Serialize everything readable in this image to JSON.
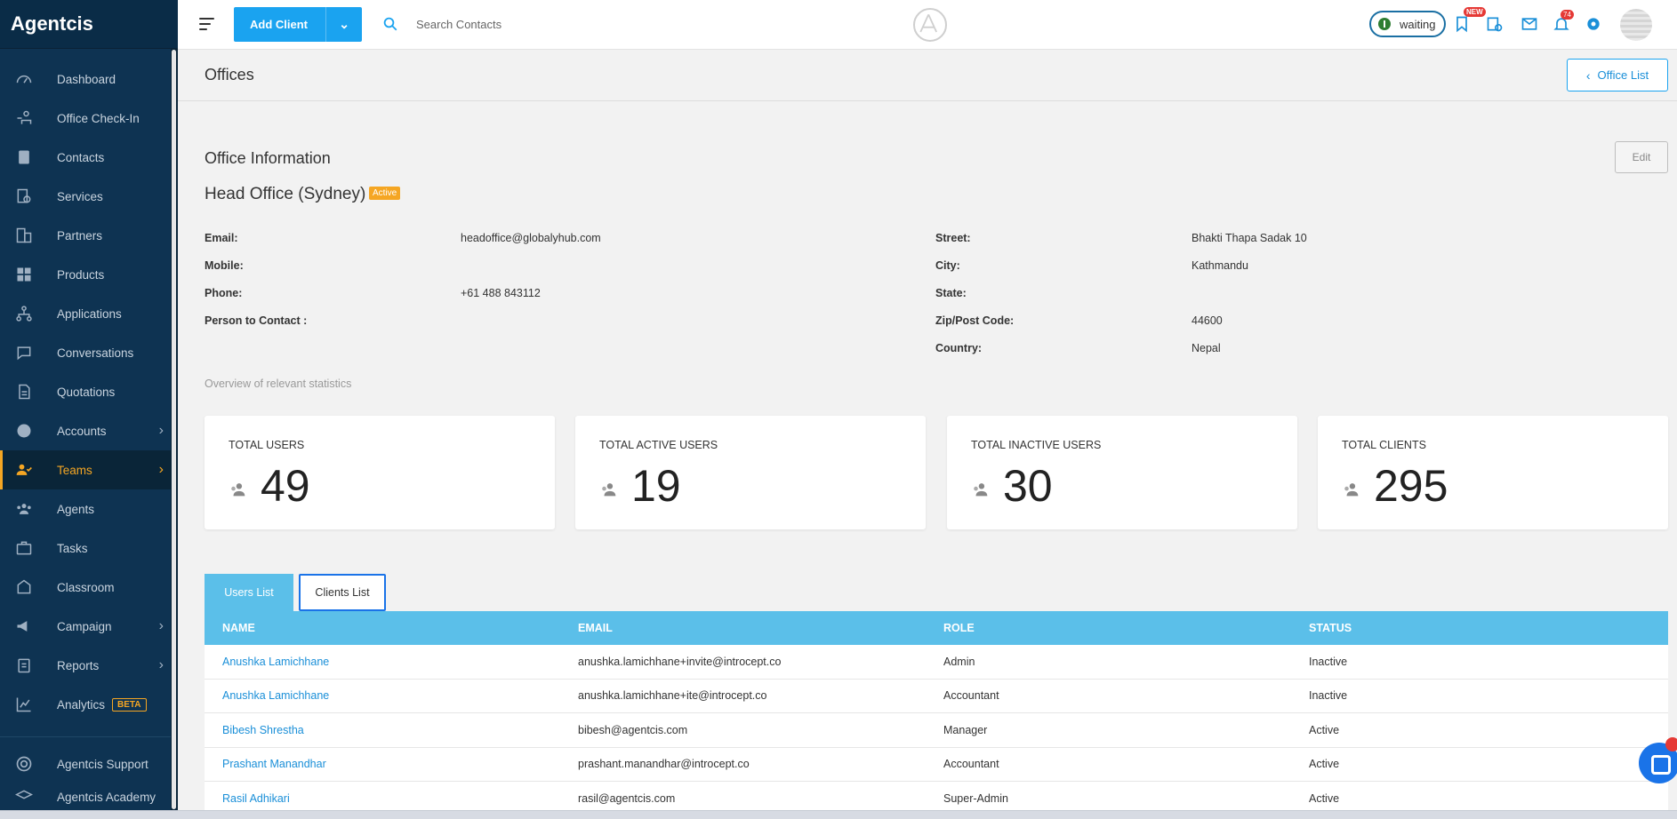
{
  "app": {
    "brand": "Agentcis"
  },
  "sidebar": {
    "items": [
      {
        "label": "Dashboard",
        "icon": "dashboard-icon"
      },
      {
        "label": "Office Check-In",
        "icon": "office-checkin-icon"
      },
      {
        "label": "Contacts",
        "icon": "contacts-icon"
      },
      {
        "label": "Services",
        "icon": "services-icon"
      },
      {
        "label": "Partners",
        "icon": "partners-icon"
      },
      {
        "label": "Products",
        "icon": "products-icon"
      },
      {
        "label": "Applications",
        "icon": "applications-icon"
      },
      {
        "label": "Conversations",
        "icon": "conversations-icon"
      },
      {
        "label": "Quotations",
        "icon": "quotations-icon"
      },
      {
        "label": "Accounts",
        "icon": "accounts-icon",
        "expandable": true
      },
      {
        "label": "Teams",
        "icon": "teams-icon",
        "expandable": true,
        "active": true
      },
      {
        "label": "Agents",
        "icon": "agents-icon"
      },
      {
        "label": "Tasks",
        "icon": "tasks-icon"
      },
      {
        "label": "Classroom",
        "icon": "classroom-icon"
      },
      {
        "label": "Campaign",
        "icon": "campaign-icon",
        "expandable": true
      },
      {
        "label": "Reports",
        "icon": "reports-icon",
        "expandable": true
      },
      {
        "label": "Analytics",
        "icon": "analytics-icon",
        "badge": "BETA"
      }
    ],
    "footer_items": [
      {
        "label": "Agentcis Support",
        "icon": "support-icon"
      },
      {
        "label": "Agentcis Academy",
        "icon": "academy-icon"
      }
    ]
  },
  "topbar": {
    "add_client_label": "Add Client",
    "search_placeholder": "Search Contacts",
    "status_label": "waiting",
    "new_badge": "NEW",
    "notification_count": "74"
  },
  "page": {
    "title": "Offices",
    "office_list_label": "Office List",
    "section_title": "Office Information",
    "edit_label": "Edit",
    "office_name": "Head Office (Sydney)",
    "office_status": "Active",
    "overview_text": "Overview of relevant statistics"
  },
  "info": {
    "left": [
      {
        "label": "Email:",
        "value": "headoffice@globalyhub.com"
      },
      {
        "label": "Mobile:",
        "value": ""
      },
      {
        "label": "Phone:",
        "value": "+61 488 843112"
      },
      {
        "label": "Person to Contact :",
        "value": ""
      }
    ],
    "right": [
      {
        "label": "Street:",
        "value": "Bhakti Thapa Sadak 10"
      },
      {
        "label": "City:",
        "value": "Kathmandu"
      },
      {
        "label": "State:",
        "value": ""
      },
      {
        "label": "Zip/Post Code:",
        "value": "44600"
      },
      {
        "label": "Country:",
        "value": "Nepal"
      }
    ]
  },
  "stats": [
    {
      "label": "TOTAL USERS",
      "value": "49"
    },
    {
      "label": "TOTAL ACTIVE USERS",
      "value": "19"
    },
    {
      "label": "TOTAL INACTIVE USERS",
      "value": "30"
    },
    {
      "label": "TOTAL CLIENTS",
      "value": "295"
    }
  ],
  "tabs": {
    "users": "Users List",
    "clients": "Clients List"
  },
  "table": {
    "headers": [
      "NAME",
      "EMAIL",
      "ROLE",
      "STATUS"
    ],
    "rows": [
      [
        "Anushka Lamichhane",
        "anushka.lamichhane+invite@introcept.co",
        "Admin",
        "Inactive"
      ],
      [
        "Anushka Lamichhane",
        "anushka.lamichhane+ite@introcept.co",
        "Accountant",
        "Inactive"
      ],
      [
        "Bibesh Shrestha",
        "bibesh@agentcis.com",
        "Manager",
        "Active"
      ],
      [
        "Prashant Manandhar",
        "prashant.manandhar@introcept.co",
        "Accountant",
        "Active"
      ],
      [
        "Rasil Adhikari",
        "rasil@agentcis.com",
        "Super-Admin",
        "Active"
      ]
    ]
  },
  "colors": {
    "sidebar_bg": "#0e3352",
    "accent_blue": "#1aa3f0",
    "active_orange": "#f5a623",
    "table_header": "#5bbfe9"
  }
}
